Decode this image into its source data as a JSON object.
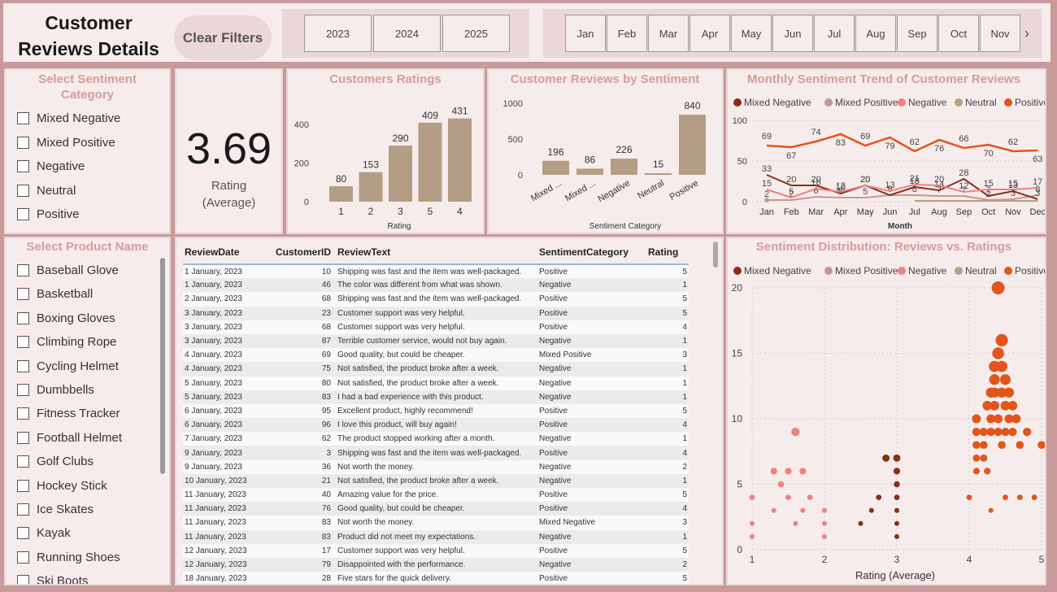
{
  "header": {
    "title_line1": "Customer",
    "title_line2": "Reviews Details",
    "clear_filters": "Clear Filters",
    "years": [
      "2023",
      "2024",
      "2025"
    ],
    "months": [
      "Jan",
      "Feb",
      "Mar",
      "Apr",
      "May",
      "Jun",
      "Jul",
      "Aug",
      "Sep",
      "Oct",
      "Nov"
    ],
    "chevron": "›"
  },
  "sentiment_slicer": {
    "title": "Select Sentiment Category",
    "items": [
      "Mixed Negative",
      "Mixed Positive",
      "Negative",
      "Neutral",
      "Positive"
    ]
  },
  "kpi": {
    "value": "3.69",
    "label_line1": "Rating",
    "label_line2": "(Average)"
  },
  "product_slicer": {
    "title": "Select Product Name",
    "items": [
      "Baseball Glove",
      "Basketball",
      "Boxing Gloves",
      "Climbing Rope",
      "Cycling Helmet",
      "Dumbbells",
      "Fitness Tracker",
      "Football Helmet",
      "Golf Clubs",
      "Hockey Stick",
      "Ice Skates",
      "Kayak",
      "Running Shoes",
      "Ski Boots"
    ]
  },
  "colors": {
    "background": "#c9999b",
    "panel": "#f6ecec",
    "panel_title": "#d89a9c",
    "bar": "#b39d84",
    "mixed_negative": "#8b2e16",
    "mixed_positive": "#c69796",
    "negative": "#f08080",
    "neutral": "#b8a080",
    "positive": "#e2551a"
  },
  "chart_data": [
    {
      "type": "bar",
      "title": "Customers Ratings",
      "xlabel": "Rating",
      "ylabel": "",
      "categories": [
        "1",
        "2",
        "3",
        "5",
        "4"
      ],
      "values": [
        80,
        153,
        290,
        409,
        431
      ],
      "yticks": [
        "0",
        "200",
        "400"
      ],
      "ylim": [
        0,
        480
      ]
    },
    {
      "type": "bar",
      "title": "Customer Reviews by Sentiment",
      "xlabel": "Sentiment Category",
      "ylabel": "",
      "categories": [
        "Mixed ...",
        "Mixed ...",
        "Negative",
        "Neutral",
        "Positive"
      ],
      "values": [
        196,
        86,
        226,
        15,
        840
      ],
      "yticks": [
        "0",
        "500",
        "1000"
      ],
      "ylim": [
        0,
        1000
      ]
    },
    {
      "type": "line",
      "title": "Monthly Sentiment Trend of Customer Reviews",
      "xlabel": "Month",
      "ylabel": "",
      "x": [
        "Jan",
        "Feb",
        "Mar",
        "Apr",
        "May",
        "Jun",
        "Jul",
        "Aug",
        "Sep",
        "Oct",
        "Nov",
        "Dec"
      ],
      "yticks": [
        "0",
        "50",
        "100"
      ],
      "ylim": [
        0,
        100
      ],
      "legend": [
        "Mixed Negative",
        "Mixed Positive",
        "Negative",
        "Neutral",
        "Positive"
      ],
      "series": [
        {
          "name": "Positive",
          "values": [
            69,
            67,
            74,
            83,
            69,
            79,
            62,
            76,
            66,
            70,
            62,
            63
          ]
        },
        {
          "name": "Negative",
          "values": [
            15,
            5,
            16,
            12,
            20,
            13,
            21,
            20,
            12,
            15,
            15,
            17
          ]
        },
        {
          "name": "Mixed Negative",
          "values": [
            33,
            20,
            20,
            10,
            20,
            8,
            18,
            14,
            28,
            7,
            13,
            3
          ]
        },
        {
          "name": "Mixed Positive",
          "values": [
            2,
            2,
            6,
            5,
            5,
            8,
            8,
            7,
            7,
            2,
            3,
            8
          ]
        },
        {
          "name": "Neutral",
          "values": [
            1,
            null,
            null,
            0,
            null,
            null,
            1,
            1,
            1,
            1,
            1,
            1
          ]
        }
      ]
    },
    {
      "type": "scatter",
      "title": "Sentiment Distribution: Reviews vs. Ratings",
      "xlabel": "Rating (Average)",
      "ylabel": "",
      "xticks": [
        "1",
        "2",
        "3",
        "4",
        "5"
      ],
      "yticks": [
        "0",
        "5",
        "10",
        "15",
        "20"
      ],
      "xlim": [
        1,
        5
      ],
      "ylim": [
        0,
        20
      ],
      "legend": [
        "Mixed Negative",
        "Mixed Positive",
        "Negative",
        "Neutral",
        "Positive"
      ],
      "series": [
        {
          "name": "Negative",
          "points": [
            [
              1,
              4
            ],
            [
              1,
              2
            ],
            [
              1,
              1
            ],
            [
              1.3,
              6
            ],
            [
              1.3,
              3
            ],
            [
              1.4,
              5
            ],
            [
              1.5,
              6
            ],
            [
              1.5,
              4
            ],
            [
              1.6,
              9
            ],
            [
              1.6,
              2
            ],
            [
              1.7,
              6
            ],
            [
              1.7,
              3
            ],
            [
              1.8,
              4
            ],
            [
              2,
              3
            ],
            [
              2,
              2
            ],
            [
              2,
              1
            ]
          ]
        },
        {
          "name": "Mixed Negative",
          "points": [
            [
              2.5,
              2
            ],
            [
              2.65,
              3
            ],
            [
              2.75,
              4
            ],
            [
              2.85,
              7
            ],
            [
              3,
              7
            ],
            [
              3,
              6
            ],
            [
              3,
              5
            ],
            [
              3,
              4
            ],
            [
              3,
              3
            ],
            [
              3,
              2
            ],
            [
              3,
              1
            ]
          ]
        },
        {
          "name": "Positive",
          "points": [
            [
              4.1,
              10
            ],
            [
              4.1,
              9
            ],
            [
              4.1,
              8
            ],
            [
              4.1,
              7
            ],
            [
              4.1,
              6
            ],
            [
              4.2,
              9
            ],
            [
              4.2,
              8
            ],
            [
              4.2,
              7
            ],
            [
              4.25,
              11
            ],
            [
              4.25,
              6
            ],
            [
              4.3,
              12
            ],
            [
              4.3,
              10
            ],
            [
              4.3,
              9
            ],
            [
              4.35,
              14
            ],
            [
              4.35,
              13
            ],
            [
              4.35,
              12
            ],
            [
              4.35,
              11
            ],
            [
              4.4,
              20
            ],
            [
              4.4,
              15
            ],
            [
              4.4,
              10
            ],
            [
              4.4,
              9
            ],
            [
              4.45,
              16
            ],
            [
              4.45,
              14
            ],
            [
              4.45,
              12
            ],
            [
              4.45,
              8
            ],
            [
              4.5,
              13
            ],
            [
              4.5,
              11
            ],
            [
              4.5,
              9
            ],
            [
              4.55,
              12
            ],
            [
              4.55,
              10
            ],
            [
              4.6,
              11
            ],
            [
              4.6,
              9
            ],
            [
              4.65,
              10
            ],
            [
              4.7,
              8
            ],
            [
              4.8,
              9
            ],
            [
              5,
              8
            ],
            [
              4,
              4
            ],
            [
              4.3,
              3
            ],
            [
              4.5,
              4
            ],
            [
              4.7,
              4
            ],
            [
              4.9,
              4
            ]
          ]
        }
      ]
    }
  ],
  "table": {
    "columns": [
      "ReviewDate",
      "CustomerID",
      "ReviewText",
      "SentimentCategory",
      "Rating"
    ],
    "rows": [
      [
        "1 January, 2023",
        "10",
        "Shipping was fast and the item was well-packaged.",
        "Positive",
        "5"
      ],
      [
        "1 January, 2023",
        "46",
        "The color was different from what was shown.",
        "Negative",
        "1"
      ],
      [
        "2 January, 2023",
        "68",
        "Shipping was fast and the item was well-packaged.",
        "Positive",
        "5"
      ],
      [
        "3 January, 2023",
        "23",
        "Customer support was very helpful.",
        "Positive",
        "5"
      ],
      [
        "3 January, 2023",
        "68",
        "Customer support was very helpful.",
        "Positive",
        "4"
      ],
      [
        "3 January, 2023",
        "87",
        "Terrible customer service, would not buy again.",
        "Negative",
        "1"
      ],
      [
        "4 January, 2023",
        "69",
        "Good quality, but could be cheaper.",
        "Mixed Positive",
        "3"
      ],
      [
        "4 January, 2023",
        "75",
        "Not satisfied, the product broke after a week.",
        "Negative",
        "1"
      ],
      [
        "5 January, 2023",
        "80",
        "Not satisfied, the product broke after a week.",
        "Negative",
        "1"
      ],
      [
        "5 January, 2023",
        "83",
        "I had a bad experience with this product.",
        "Negative",
        "1"
      ],
      [
        "6 January, 2023",
        "95",
        "Excellent product, highly recommend!",
        "Positive",
        "5"
      ],
      [
        "6 January, 2023",
        "96",
        "I love this product, will buy again!",
        "Positive",
        "4"
      ],
      [
        "7 January, 2023",
        "62",
        "The product stopped working after a month.",
        "Negative",
        "1"
      ],
      [
        "9 January, 2023",
        "3",
        "Shipping was fast and the item was well-packaged.",
        "Positive",
        "4"
      ],
      [
        "9 January, 2023",
        "36",
        "Not worth the money.",
        "Negative",
        "2"
      ],
      [
        "10 January, 2023",
        "21",
        "Not satisfied, the product broke after a week.",
        "Negative",
        "1"
      ],
      [
        "11 January, 2023",
        "40",
        "Amazing value for the price.",
        "Positive",
        "5"
      ],
      [
        "11 January, 2023",
        "76",
        "Good quality, but could be cheaper.",
        "Positive",
        "4"
      ],
      [
        "11 January, 2023",
        "83",
        "Not worth the money.",
        "Mixed Negative",
        "3"
      ],
      [
        "11 January, 2023",
        "83",
        "Product did not meet my expectations.",
        "Negative",
        "1"
      ],
      [
        "12 January, 2023",
        "17",
        "Customer support was very helpful.",
        "Positive",
        "5"
      ],
      [
        "12 January, 2023",
        "79",
        "Disappointed with the performance.",
        "Negative",
        "2"
      ],
      [
        "18 January, 2023",
        "28",
        "Five stars for the quick delivery.",
        "Positive",
        "5"
      ]
    ]
  }
}
